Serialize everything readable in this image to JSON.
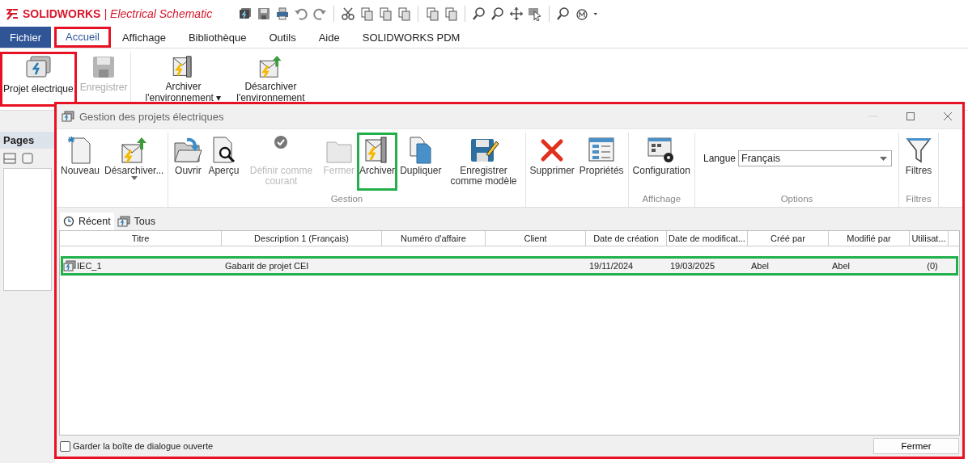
{
  "app": {
    "brand": "SOLIDWORKS",
    "separator": "|",
    "product": "Electrical Schematic"
  },
  "menu": [
    {
      "label": "Fichier",
      "kind": "file",
      "selected": false
    },
    {
      "label": "Accueil",
      "kind": "tab",
      "selected": true,
      "color": "#e81123"
    },
    {
      "label": "Affichage",
      "kind": "tab",
      "selected": false
    },
    {
      "label": "Bibliothèque",
      "kind": "tab",
      "selected": false
    },
    {
      "label": "Outils",
      "kind": "tab",
      "selected": false
    },
    {
      "label": "Aide",
      "kind": "tab",
      "selected": false
    },
    {
      "label": "SOLIDWORKS PDM",
      "kind": "tab",
      "selected": false
    }
  ],
  "ribbon": [
    {
      "label": "Projet électrique",
      "disabled": false,
      "color": "#e81123"
    },
    {
      "label": "Enregistrer",
      "disabled": true
    },
    {
      "label": "Archiver l'environnement ▾",
      "disabled": false
    },
    {
      "label": "Désarchiver l'environnement",
      "disabled": false
    }
  ],
  "sidebar": {
    "title": "Pages"
  },
  "dialog": {
    "title": "Gestion des projets électriques",
    "color": "#e81123",
    "groups": [
      {
        "kind": "buttons",
        "items": [
          {
            "label": "Nouveau",
            "disabled": false,
            "dropdown": false
          },
          {
            "label": "Désarchiver...",
            "disabled": false,
            "dropdown": true
          }
        ]
      },
      {
        "label": "Gestion",
        "kind": "buttons",
        "items": [
          {
            "label": "Ouvrir",
            "disabled": false,
            "dropdown": false
          },
          {
            "label": "Aperçu",
            "disabled": false,
            "dropdown": false
          },
          {
            "label": "Définir comme courant",
            "disabled": true,
            "dropdown": false
          },
          {
            "label": "Fermer",
            "disabled": true,
            "dropdown": false
          },
          {
            "label": "Archiver",
            "disabled": false,
            "dropdown": false,
            "color": "#22b04b"
          },
          {
            "label": "Dupliquer",
            "disabled": false,
            "dropdown": false
          },
          {
            "label": "Enregistrer comme modèle",
            "disabled": false,
            "dropdown": false
          }
        ]
      },
      {
        "kind": "buttons",
        "items": [
          {
            "label": "Supprimer",
            "disabled": false,
            "dropdown": false
          },
          {
            "label": "Propriétés",
            "disabled": false,
            "dropdown": false
          }
        ]
      },
      {
        "label": "Affichage",
        "kind": "buttons",
        "items": [
          {
            "label": "Configuration",
            "disabled": false,
            "dropdown": false
          }
        ]
      },
      {
        "label": "Options",
        "kind": "combo",
        "field_label": "Langue",
        "value": "Français"
      },
      {
        "label": "Filtres",
        "kind": "buttons",
        "items": [
          {
            "label": "Filtres",
            "disabled": false,
            "dropdown": false
          }
        ]
      }
    ],
    "tabs": [
      {
        "label": "Récent",
        "selected": true
      },
      {
        "label": "Tous",
        "selected": false
      }
    ],
    "columns": [
      "Titre",
      "Description 1 (Français)",
      "Numéro d'affaire",
      "Client",
      "Date de création",
      "Date de modificat...",
      "Créé par",
      "Modifié par",
      "Utilisat..."
    ],
    "rows": [
      {
        "title": "IEC_1",
        "description": "Gabarit de projet CEI",
        "created": "19/11/2024",
        "modified": "19/03/2025",
        "created_by": "Abel",
        "modified_by": "Abel",
        "usage": "(0)",
        "color": "#22b04b"
      }
    ],
    "keep_open": {
      "label": "Garder la boîte de dialogue ouverte",
      "checked": false
    },
    "close_button": "Fermer"
  }
}
